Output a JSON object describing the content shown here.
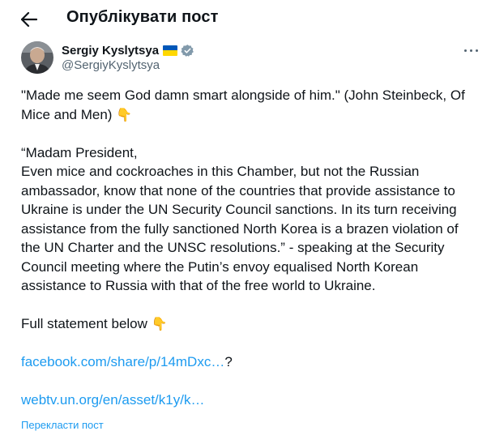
{
  "header": {
    "title": "Опублікувати пост"
  },
  "author": {
    "name": "Sergiy Kyslytsya",
    "handle": "@SergiyKyslytsya"
  },
  "post": {
    "line1": "\"Made me seem God damn smart alongside of him.\" (John Steinbeck, Of",
    "line2": "Mice and Men)",
    "line3": "“Madam President,",
    "line4": "Even mice and cockroaches in this Chamber, but not the Russian",
    "line5": "ambassador, know that none of the countries that provide assistance to",
    "line6": "Ukraine is under the UN Security Council sanctions. In its turn receiving",
    "line7": "assistance from the fully sanctioned North Korea is a brazen violation of",
    "line8": "the UN Charter and the UNSC resolutions.” - speaking at the Security",
    "line9": "Council meeting where the Putin’s envoy equalised North Korean",
    "line10": "assistance to Russia with that of the free world to Ukraine.",
    "line11": "Full statement below",
    "link1": "facebook.com/share/p/14mDxc…",
    "link1_suffix": "?",
    "link2": "webtv.un.org/en/asset/k1y/k…",
    "emoji": "👇"
  },
  "translate_label": "Перекласти пост",
  "colors": {
    "link": "#1d9bf0",
    "muted": "#536471",
    "text": "#0f1419",
    "flag_blue": "#0057b7",
    "flag_yellow": "#ffd700"
  }
}
